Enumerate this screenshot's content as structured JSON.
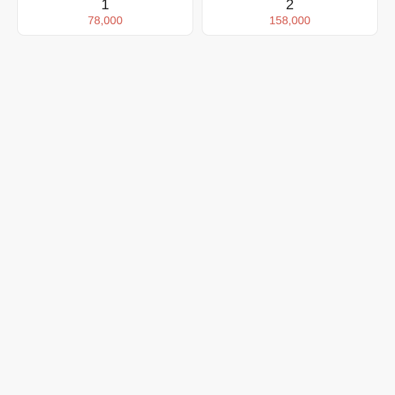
{
  "options": [
    {
      "label": "1",
      "price": "78,000"
    },
    {
      "label": "2",
      "price": "158,000"
    }
  ],
  "colors": {
    "background": "#f8f8f8",
    "card": "#ffffff",
    "price": "#d35a4f"
  }
}
